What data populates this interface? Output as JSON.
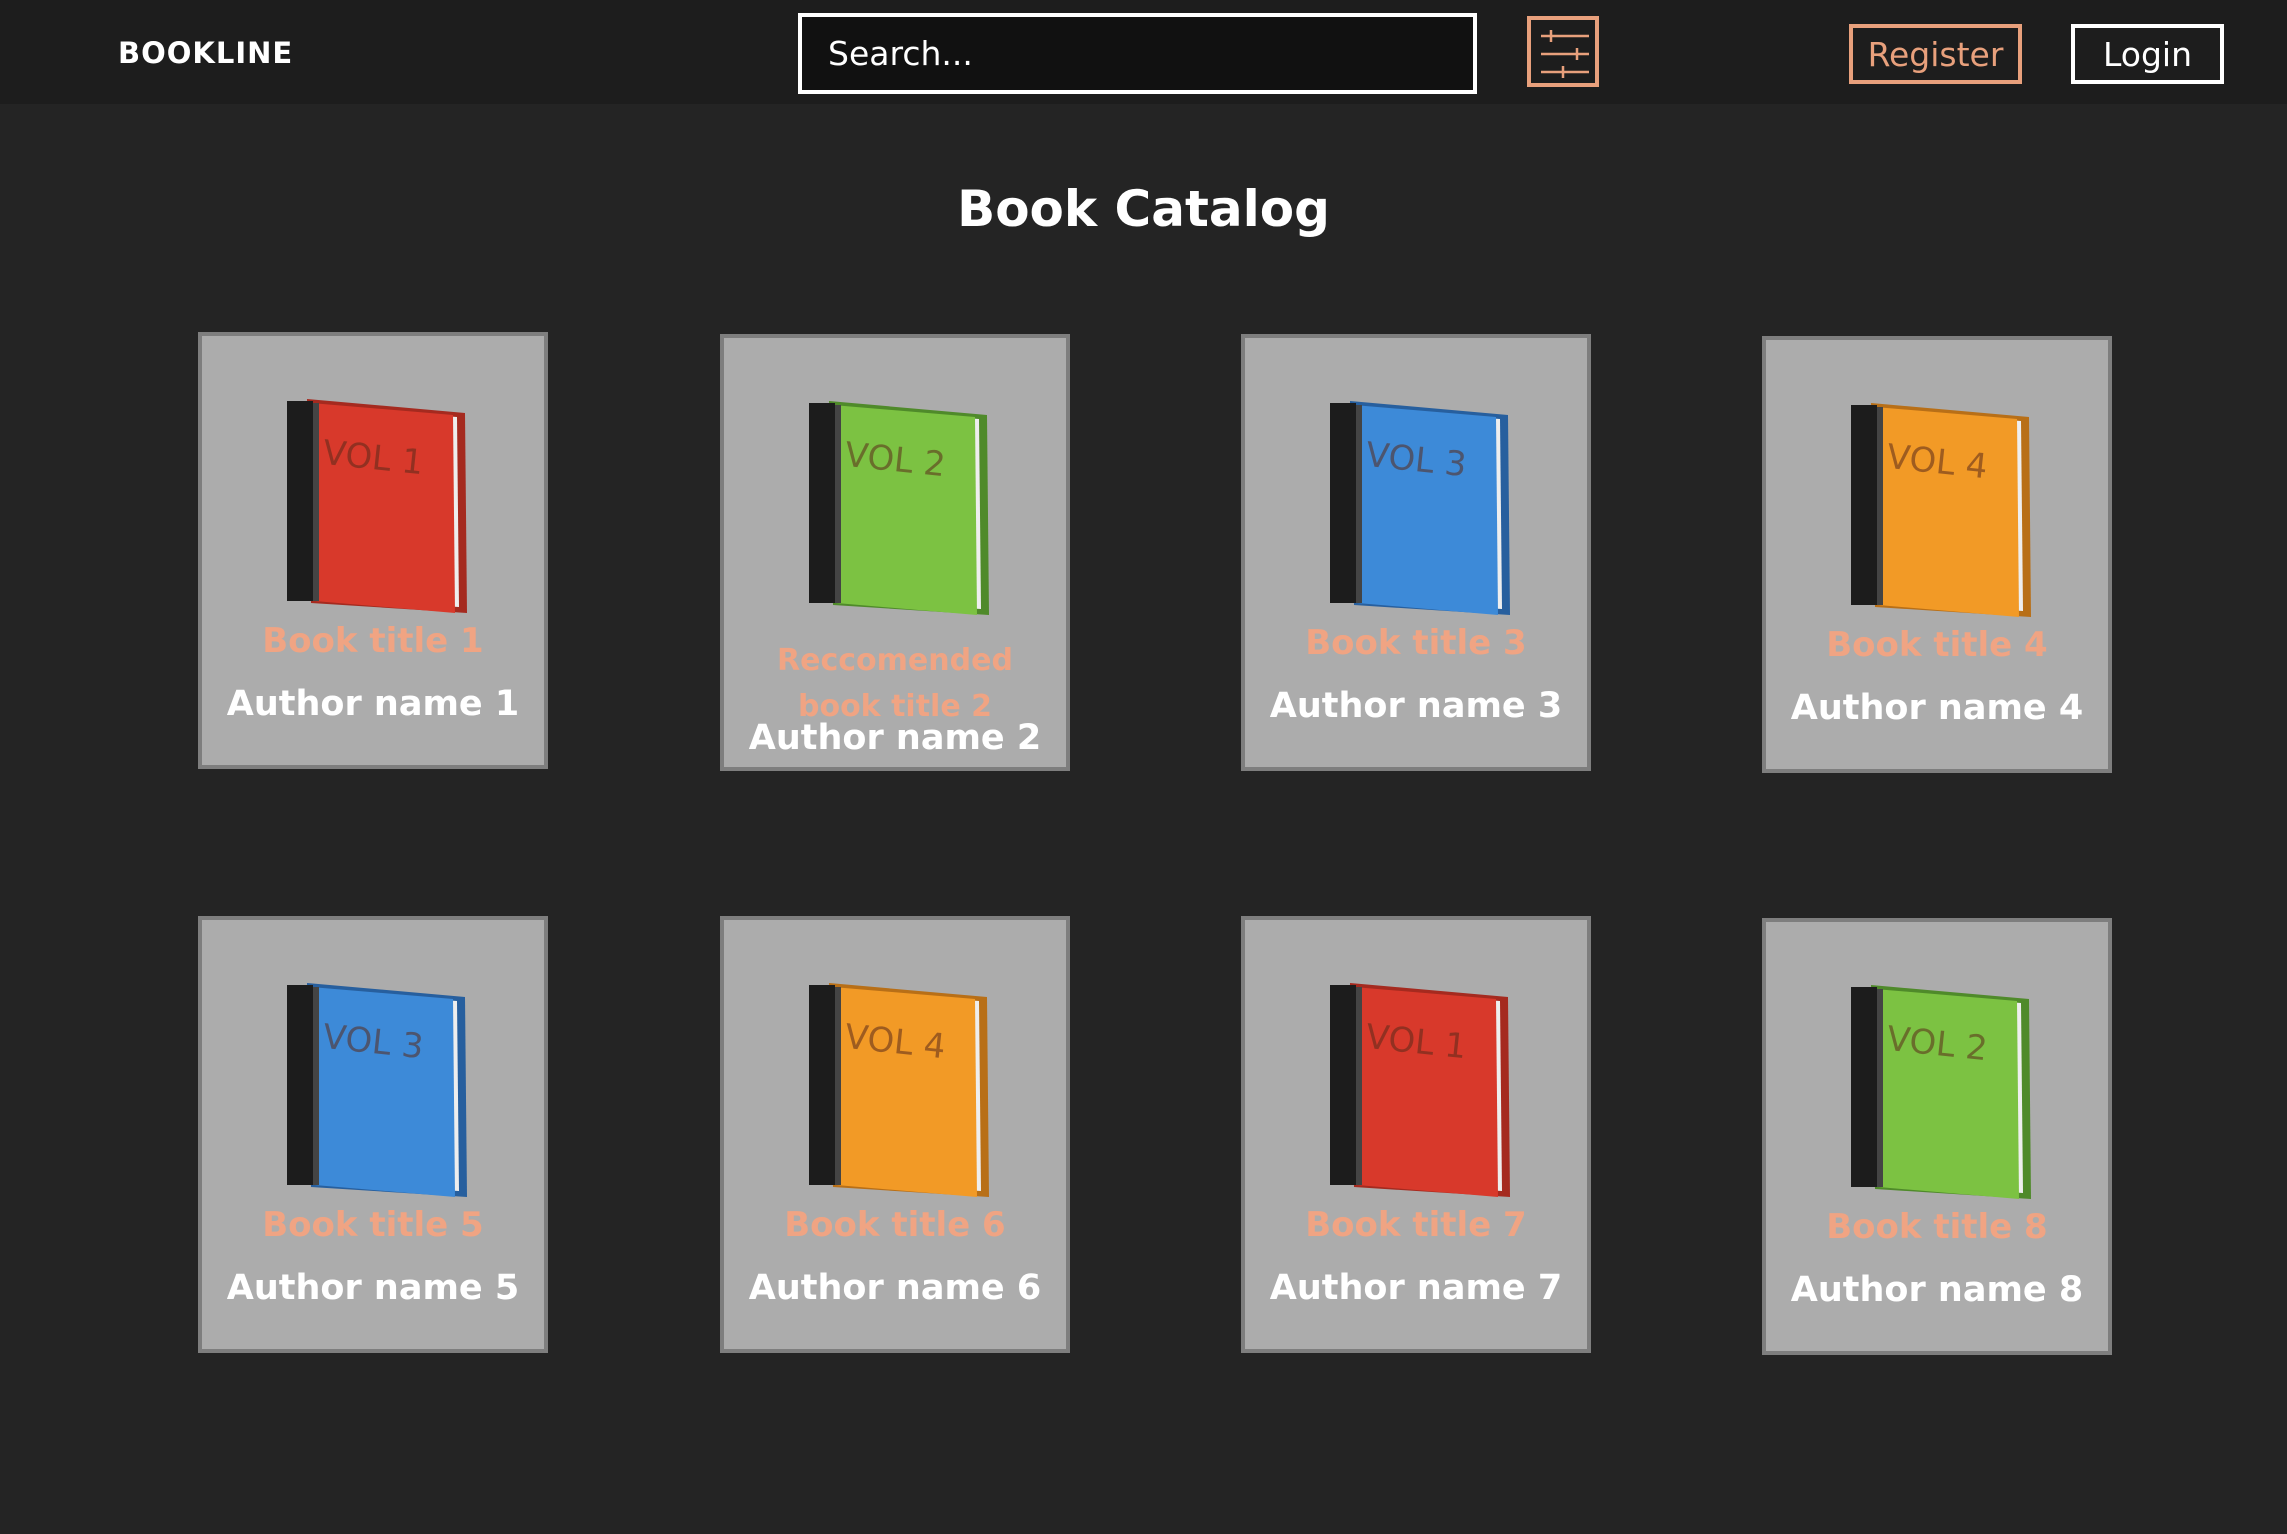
{
  "header": {
    "brand": "BOOKLINE",
    "search_placeholder": "Search...",
    "filter_icon": "sliders-icon",
    "register_label": "Register",
    "login_label": "Login"
  },
  "colors": {
    "accent": "#e8a07c",
    "background": "#242424",
    "card": "#acacac"
  },
  "page_title": "Book Catalog",
  "books": [
    {
      "title": "Book title 1",
      "author": "Author name 1",
      "vol": "VOL 1",
      "color": "#d8392b",
      "dark": "#a52a1f"
    },
    {
      "title": "Reccomended book title 2",
      "author": "Author name 2",
      "vol": "VOL 2",
      "color": "#7cc242",
      "dark": "#4f8a2a"
    },
    {
      "title": "Book title 3",
      "author": "Author name 3",
      "vol": "VOL 3",
      "color": "#3d8ad8",
      "dark": "#275f9e"
    },
    {
      "title": "Book title 4",
      "author": "Author name 4",
      "vol": "VOL 4",
      "color": "#f29a26",
      "dark": "#b86f17"
    },
    {
      "title": "Book title 5",
      "author": "Author name 5",
      "vol": "VOL 3",
      "color": "#3d8ad8",
      "dark": "#275f9e"
    },
    {
      "title": "Book title 6",
      "author": "Author name 6",
      "vol": "VOL 4",
      "color": "#f29a26",
      "dark": "#b86f17"
    },
    {
      "title": "Book title 7",
      "author": "Author name 7",
      "vol": "VOL 1",
      "color": "#d8392b",
      "dark": "#a52a1f"
    },
    {
      "title": "Book title 8",
      "author": "Author name 8",
      "vol": "VOL 2",
      "color": "#7cc242",
      "dark": "#4f8a2a"
    }
  ]
}
